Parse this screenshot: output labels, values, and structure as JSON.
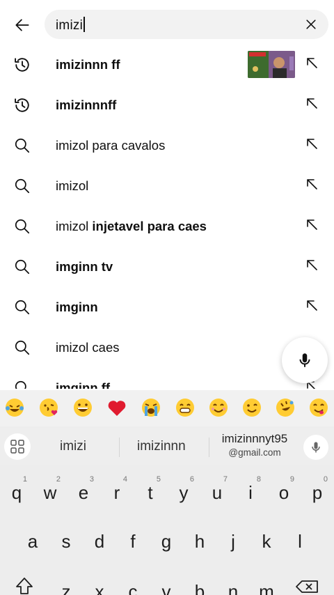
{
  "search": {
    "query": "imizi"
  },
  "suggestions": [
    {
      "type": "history",
      "icon": "history-icon",
      "text": "imizinnn ff",
      "thumbnail": true
    },
    {
      "type": "history",
      "icon": "history-icon",
      "text": "imizinnnff"
    },
    {
      "type": "search",
      "icon": "search-icon",
      "text": "imizol para cavalos"
    },
    {
      "type": "search",
      "icon": "search-icon",
      "text": "imizol"
    },
    {
      "type": "search",
      "icon": "search-icon",
      "text_pre": "imizol ",
      "text_bold": "injetavel para caes"
    },
    {
      "type": "search",
      "icon": "search-icon",
      "text": "imginn tv",
      "bold": true
    },
    {
      "type": "search",
      "icon": "search-icon",
      "text": "imginn",
      "bold": true
    },
    {
      "type": "search",
      "icon": "search-icon",
      "text": "imizol caes"
    },
    {
      "type": "search",
      "icon": "search-icon",
      "text": "imginn ff",
      "bold": true
    }
  ],
  "keyboard": {
    "emojis": [
      "laugh-tears",
      "kiss-heart",
      "grin",
      "red-heart",
      "loud-cry",
      "big-grin",
      "smile",
      "wink",
      "rolling-laugh",
      "yum"
    ],
    "word_suggestions": [
      "imizi",
      "imizinnn"
    ],
    "email_suggestion": {
      "line1": "imizinnnyt95",
      "line2": "@gmail.com"
    },
    "row1": [
      {
        "ch": "q",
        "num": "1"
      },
      {
        "ch": "w",
        "num": "2"
      },
      {
        "ch": "e",
        "num": "3"
      },
      {
        "ch": "r",
        "num": "4"
      },
      {
        "ch": "t",
        "num": "5"
      },
      {
        "ch": "y",
        "num": "6"
      },
      {
        "ch": "u",
        "num": "7"
      },
      {
        "ch": "i",
        "num": "8"
      },
      {
        "ch": "o",
        "num": "9"
      },
      {
        "ch": "p",
        "num": "0"
      }
    ],
    "row2": [
      "a",
      "s",
      "d",
      "f",
      "g",
      "h",
      "j",
      "k",
      "l"
    ],
    "row3": [
      "z",
      "x",
      "c",
      "v",
      "b",
      "n",
      "m"
    ]
  },
  "colors": {
    "search_bg": "#f2f2f2",
    "keyboard_bg": "#ededed",
    "text": "#0f0f0f"
  }
}
